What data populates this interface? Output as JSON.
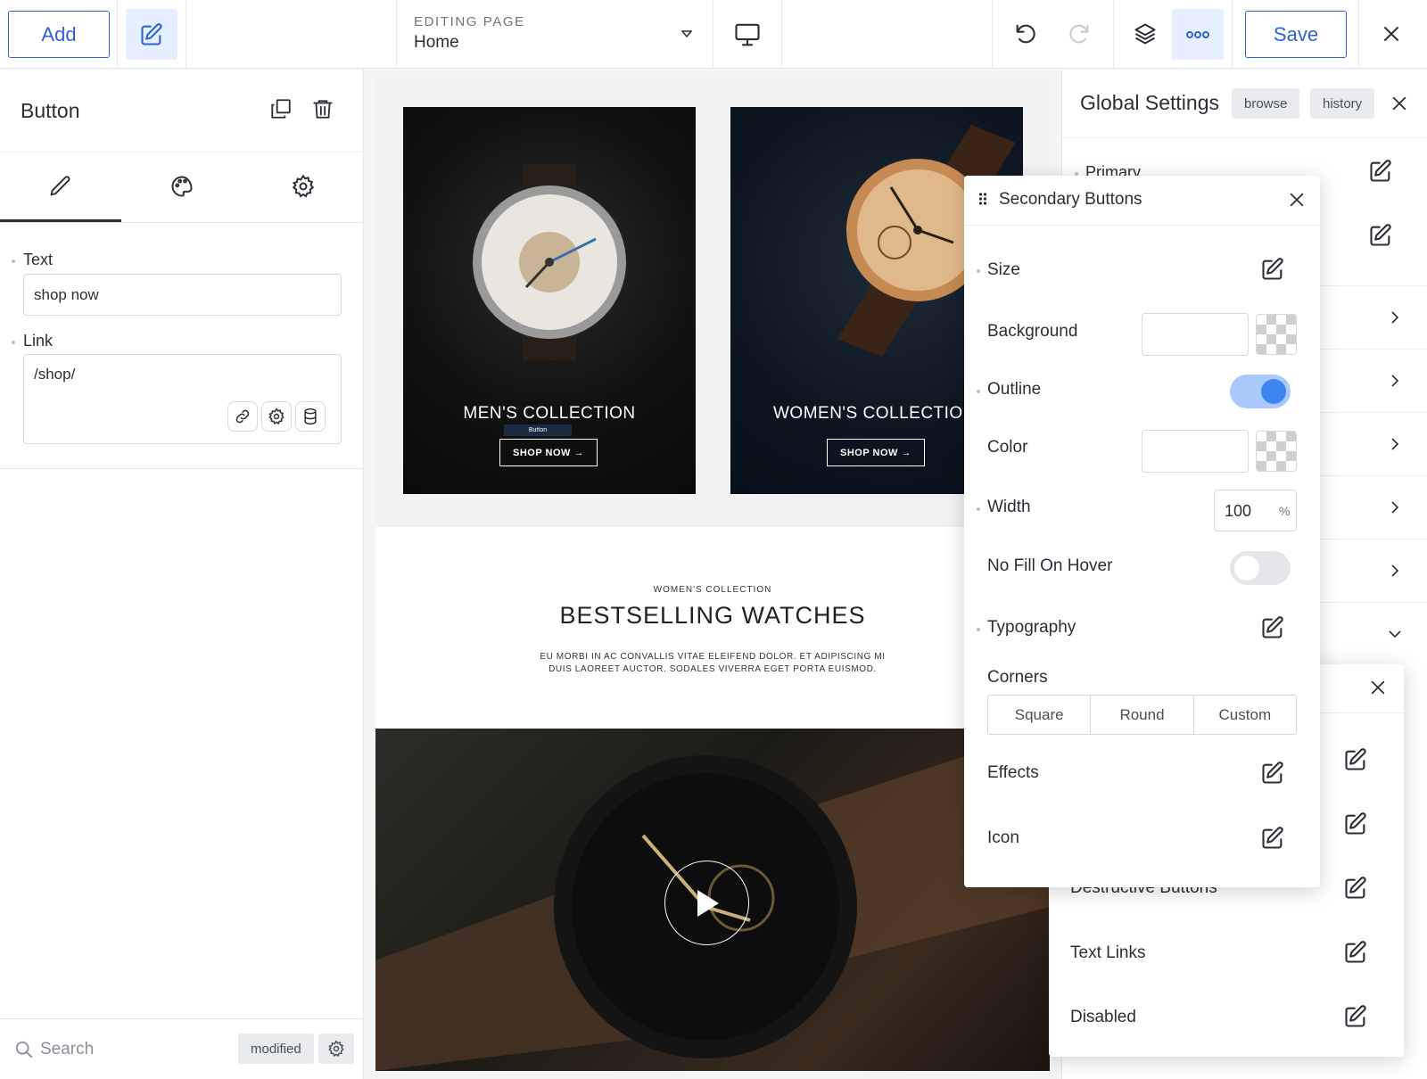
{
  "toolbar": {
    "add_label": "Add",
    "editing_caption": "EDITING PAGE",
    "page_name": "Home",
    "save_label": "Save"
  },
  "element_panel": {
    "title": "Button",
    "fields": {
      "text_label": "Text",
      "text_value": "shop now",
      "link_label": "Link",
      "link_value": "/shop/"
    },
    "search_placeholder": "Search",
    "modified_label": "modified"
  },
  "canvas": {
    "cards": [
      {
        "title": "MEN'S COLLECTION",
        "button": "SHOP NOW →"
      },
      {
        "title": "WOMEN'S COLLECTIO",
        "button": "SHOP NOW →"
      }
    ],
    "selection_badge": "Button",
    "section_kicker": "WOMEN'S COLLECTION",
    "section_title": "BESTSELLING WATCHES",
    "section_body_1": "EU MORBI IN AC CONVALLIS VITAE ELEIFEND DOLOR. ET ADIPISCING MI",
    "section_body_2": "DUIS LAOREET AUCTOR. SODALES VIVERRA EGET PORTA EUISMOD."
  },
  "global_settings": {
    "title": "Global Settings",
    "browse_label": "browse",
    "history_label": "history",
    "primary_label": "Primary"
  },
  "secondary_popup": {
    "title": "Secondary Buttons",
    "size_label": "Size",
    "background_label": "Background",
    "outline_label": "Outline",
    "outline_on": true,
    "color_label": "Color",
    "width_label": "Width",
    "width_value": "100",
    "width_unit": "%",
    "no_fill_label": "No Fill On Hover",
    "no_fill_on": false,
    "typography_label": "Typography",
    "corners_label": "Corners",
    "corners_options": [
      "Square",
      "Round",
      "Custom"
    ],
    "effects_label": "Effects",
    "icon_label": "Icon"
  },
  "lower_popup": {
    "destructive_label": "Destructive Buttons",
    "text_links_label": "Text Links",
    "disabled_label": "Disabled"
  },
  "colors": {
    "accent": "#2f63d1",
    "toggle_on": "#aac8fb",
    "toggle_knob_on": "#3e86ef"
  }
}
